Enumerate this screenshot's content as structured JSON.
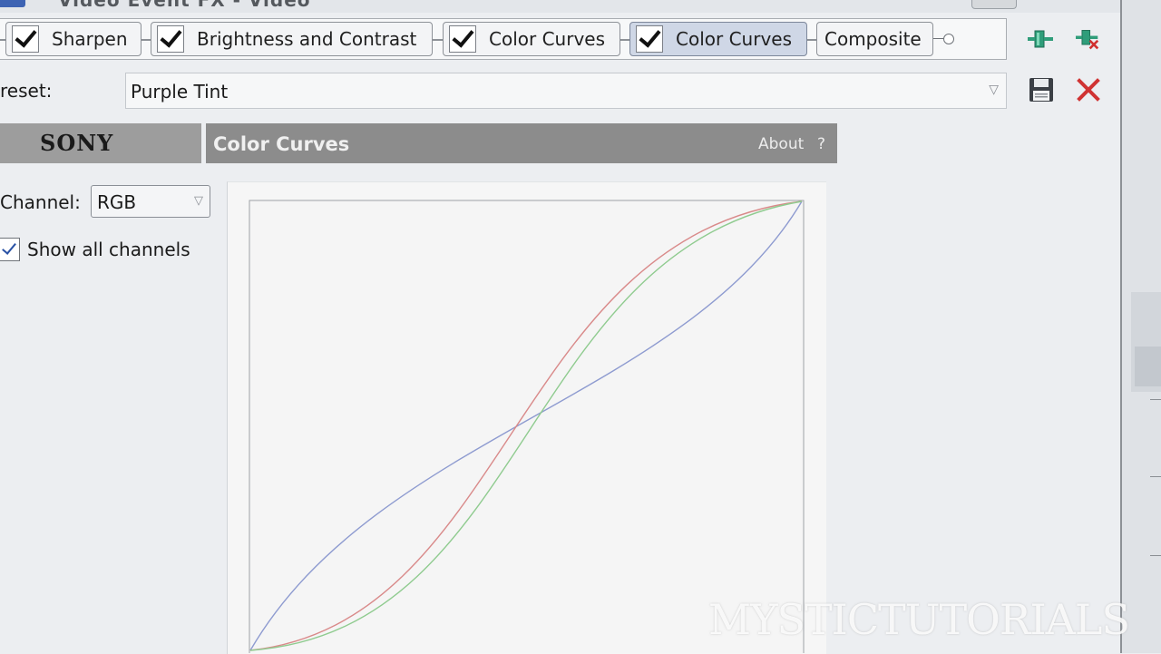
{
  "window": {
    "title_ghost": "Video Event FX - Video"
  },
  "chain": {
    "plugins": [
      {
        "label": "Sharpen",
        "checked": true,
        "active": false
      },
      {
        "label": "Brightness and Contrast",
        "checked": true,
        "active": false
      },
      {
        "label": "Color Curves",
        "checked": true,
        "active": false
      },
      {
        "label": "Color Curves",
        "checked": true,
        "active": true
      }
    ],
    "composite_label": "Composite",
    "icons": {
      "add": "plugin-add-icon",
      "remove": "plugin-remove-icon"
    }
  },
  "preset": {
    "label": "reset:",
    "value": "Purple Tint",
    "icons": {
      "save": "save-icon",
      "delete": "delete-icon"
    }
  },
  "header": {
    "brand": "SONY",
    "plugin_title": "Color Curves",
    "about": "About",
    "help": "?"
  },
  "controls": {
    "channel_label": "Channel:",
    "channel_value": "RGB",
    "show_all_label": "Show all channels",
    "show_all_checked": true
  },
  "curves": {
    "colors": {
      "red": "#d98a8a",
      "green": "#8fcb8f",
      "blue": "#8e9bd0"
    }
  },
  "watermark": "MYSTICTUTORIALS"
}
